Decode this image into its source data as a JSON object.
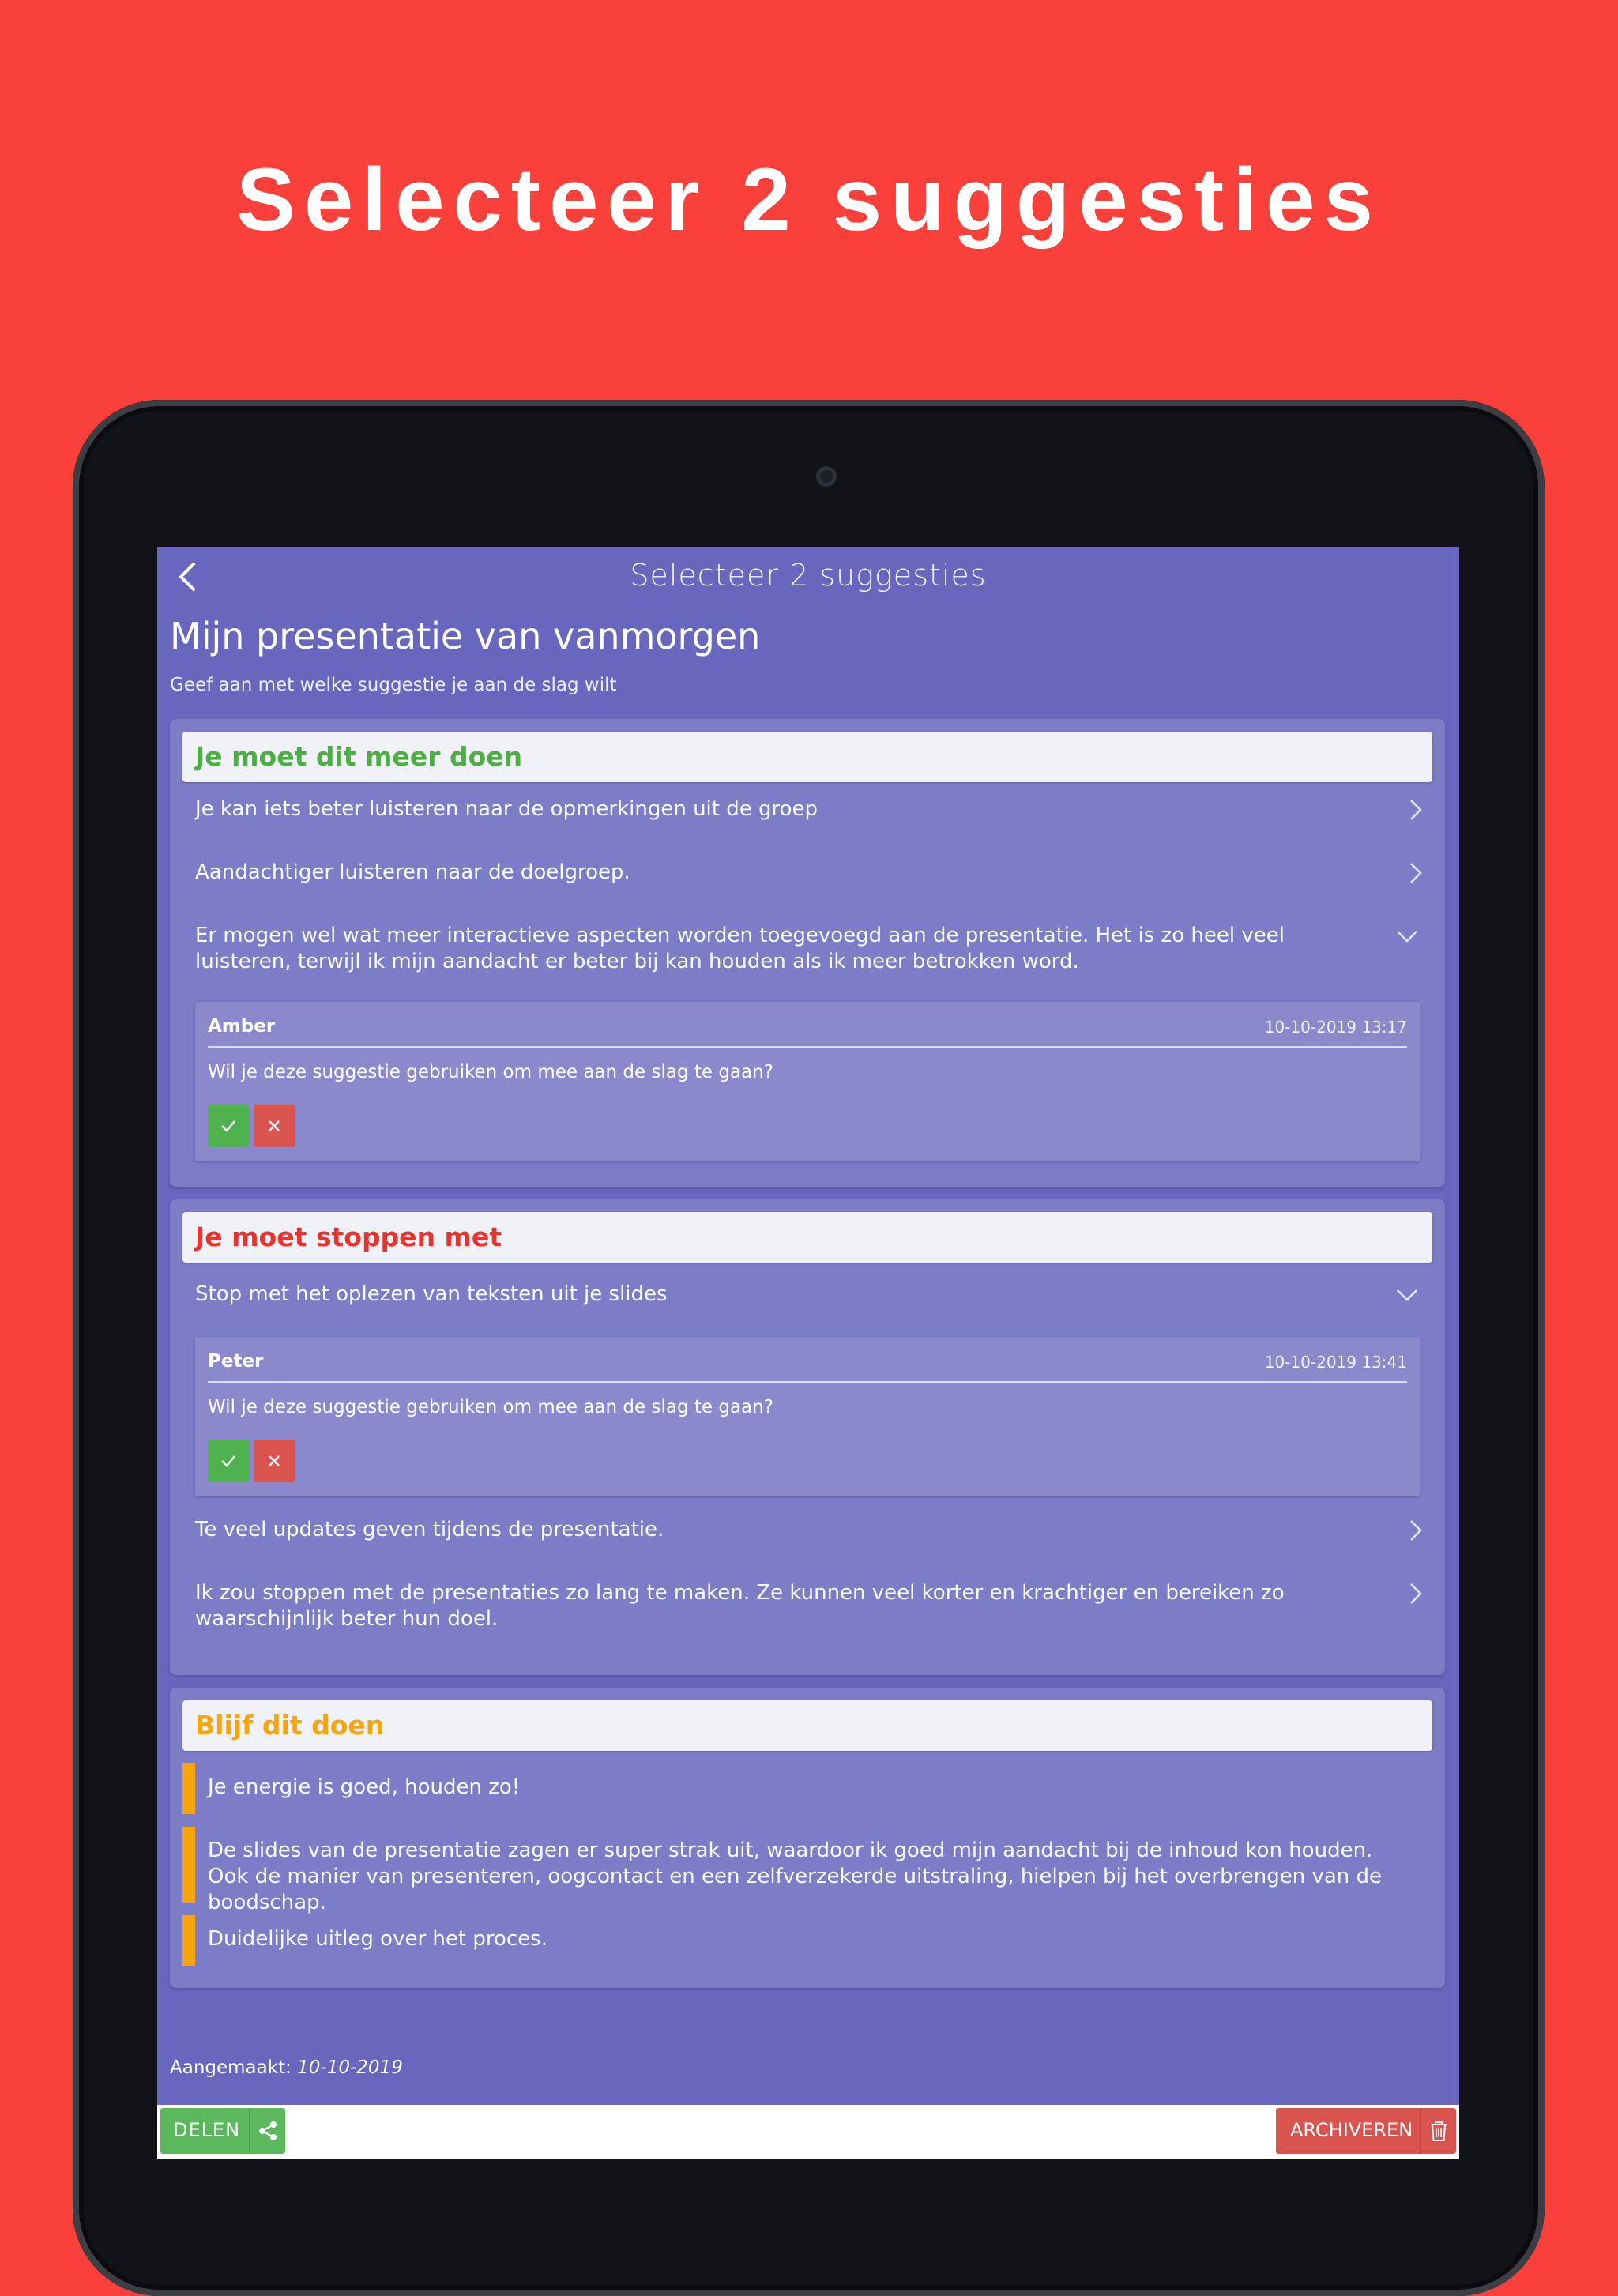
{
  "promo": {
    "headline": "Selecteer 2 suggesties"
  },
  "navbar": {
    "title": "Selecteer 2 suggesties"
  },
  "page": {
    "title": "Mijn presentatie van vanmorgen",
    "subtitle": "Geef aan met welke suggestie je aan de slag wilt"
  },
  "sections": [
    {
      "title": "Je moet dit meer doen",
      "color": "#4caf43",
      "items": [
        {
          "text": "Je kan iets beter luisteren naar de opmerkingen uit de groep",
          "expanded": false
        },
        {
          "text": "Aandachtiger luisteren naar de doelgroep.",
          "expanded": false
        },
        {
          "text": "Er mogen wel wat meer interactieve aspecten worden toegevoegd aan de presentatie. Het is zo heel veel luisteren, terwijl ik mijn aandacht er beter bij kan houden als ik meer betrokken word.",
          "expanded": true,
          "detail": {
            "author": "Amber",
            "date": "10-10-2019 13:17",
            "question": "Wil je deze suggestie gebruiken om mee aan de slag te gaan?"
          }
        }
      ]
    },
    {
      "title": "Je moet stoppen met",
      "color": "#e8342e",
      "items": [
        {
          "text": "Stop met het oplezen van teksten uit je slides",
          "expanded": true,
          "detail": {
            "author": "Peter",
            "date": "10-10-2019 13:41",
            "question": "Wil je deze suggestie gebruiken om mee aan de slag te gaan?"
          }
        },
        {
          "text": "Te veel updates geven tijdens de presentatie.",
          "expanded": false
        },
        {
          "text": "Ik zou stoppen met de presentaties zo lang te maken. Ze kunnen veel korter en krachtiger en bereiken zo waarschijnlijk beter hun doel.",
          "expanded": false
        }
      ]
    },
    {
      "title": "Blijf dit doen",
      "color": "#f6a50e",
      "items": [
        {
          "text": "Je energie is goed, houden zo!"
        },
        {
          "text": "De slides van de presentatie zagen er super strak uit, waardoor ik goed mijn aandacht bij de inhoud kon houden. Ook de manier van presenteren, oogcontact en een zelfverzekerde uitstraling, hielpen bij het overbrengen van de boodschap."
        },
        {
          "text": "Duidelijke uitleg over het proces."
        }
      ]
    }
  ],
  "created": {
    "label": "Aangemaakt:",
    "date": "10-10-2019"
  },
  "footer": {
    "share_label": "DELEN",
    "share_icon": "share-icon",
    "archive_label": "ARCHIVEREN",
    "archive_icon": "trash-icon",
    "share_color": "#5cb85c",
    "archive_color": "#d9534f"
  },
  "icons": {
    "back": "chevron-left-icon",
    "collapsed": "chevron-right-icon",
    "expanded": "chevron-down-icon",
    "accept": "check-icon",
    "reject": "close-icon"
  }
}
